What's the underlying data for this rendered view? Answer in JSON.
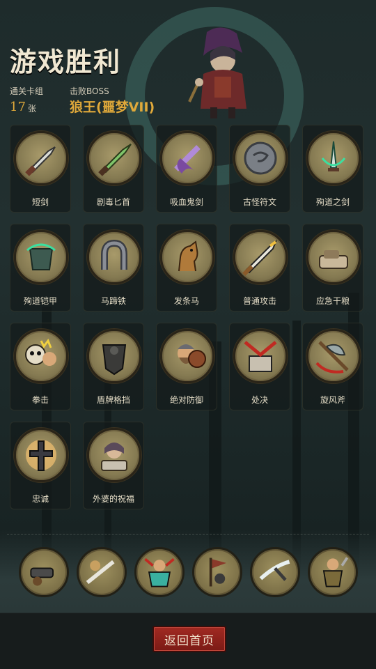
{
  "title": "游戏胜利",
  "stats": {
    "deck_label": "通关卡组",
    "deck_count": "17",
    "deck_unit": "张",
    "boss_label": "击败BOSS",
    "boss_name": "狼王(噩梦VII)"
  },
  "cards": [
    {
      "name": "短剑",
      "icon": "dagger-icon"
    },
    {
      "name": "剧毒匕首",
      "icon": "poison-dagger-icon"
    },
    {
      "name": "吸血鬼剑",
      "icon": "vampire-sword-icon"
    },
    {
      "name": "古怪符文",
      "icon": "rune-stone-icon"
    },
    {
      "name": "殉道之剑",
      "icon": "martyr-sword-icon"
    },
    {
      "name": "殉道铠甲",
      "icon": "martyr-armor-icon"
    },
    {
      "name": "马蹄铁",
      "icon": "horseshoe-icon"
    },
    {
      "name": "发条马",
      "icon": "clockwork-horse-icon"
    },
    {
      "name": "普通攻击",
      "icon": "attack-sword-icon"
    },
    {
      "name": "应急干粮",
      "icon": "ration-icon"
    },
    {
      "name": "拳击",
      "icon": "punch-skull-icon"
    },
    {
      "name": "盾牌格挡",
      "icon": "shield-block-icon"
    },
    {
      "name": "绝对防御",
      "icon": "dwarf-defender-icon"
    },
    {
      "name": "处决",
      "icon": "execute-icon"
    },
    {
      "name": "旋风斧",
      "icon": "whirlwind-axe-icon"
    },
    {
      "name": "忠诚",
      "icon": "loyalty-cross-icon"
    },
    {
      "name": "外婆的祝福",
      "icon": "grandma-blessing-icon"
    }
  ],
  "relics": [
    {
      "icon": "cannon-relic-icon"
    },
    {
      "icon": "blade-strike-relic-icon"
    },
    {
      "icon": "guardian-relic-icon"
    },
    {
      "icon": "pennant-relic-icon"
    },
    {
      "icon": "slash-relic-icon"
    },
    {
      "icon": "warrior-relic-icon"
    }
  ],
  "home_button": "返回首页",
  "colors": {
    "accent": "#e0a93a",
    "button": "#8f221c",
    "medal": "#857a52"
  }
}
